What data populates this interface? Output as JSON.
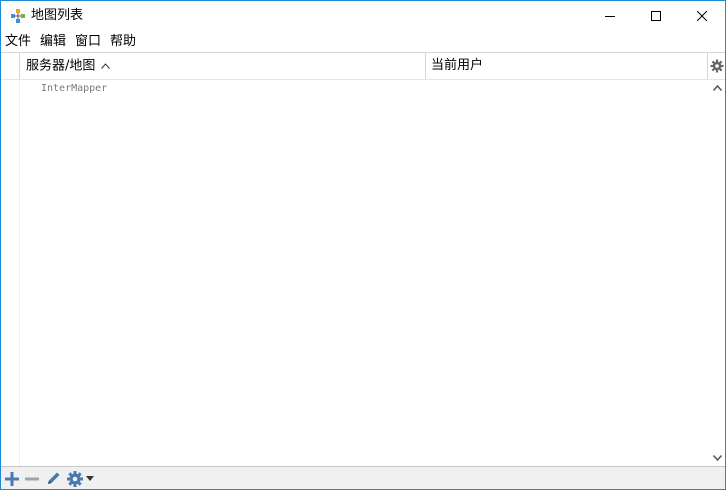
{
  "window": {
    "title": "地图列表"
  },
  "menu": {
    "items": [
      {
        "label": "文件"
      },
      {
        "label": "编辑"
      },
      {
        "label": "窗口"
      },
      {
        "label": "帮助"
      }
    ]
  },
  "table": {
    "columns": {
      "servers": "服务器/地图",
      "current_user": "当前用户"
    },
    "sort_direction": "ascending",
    "rows": [
      {
        "name": "InterMapper",
        "user": ""
      }
    ]
  },
  "toolbar": {
    "icons": [
      "plus-icon",
      "minus-icon",
      "pencil-icon",
      "gear-icon"
    ]
  },
  "colors": {
    "accent": "#1e8ad6",
    "toolbar_icon": "#4a78b0"
  }
}
